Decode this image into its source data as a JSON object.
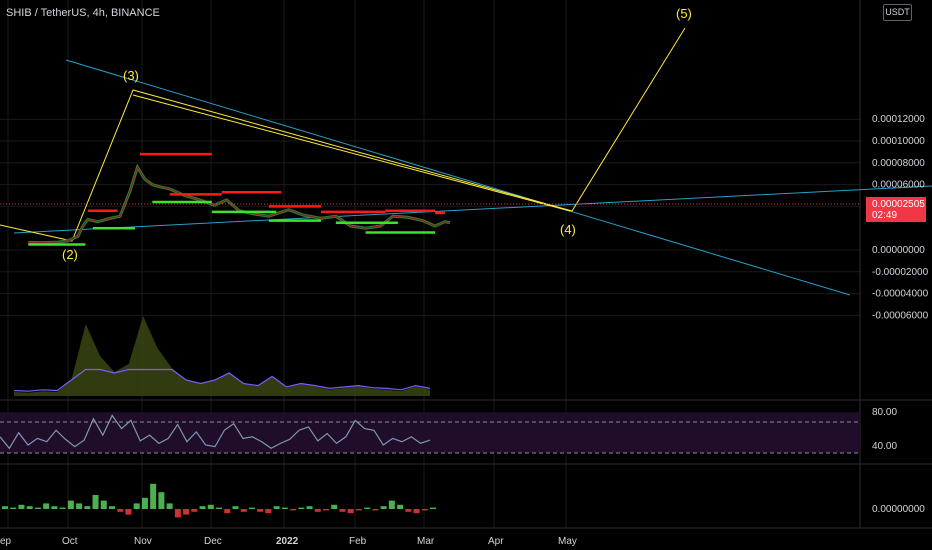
{
  "symbol": "SHIB / TetherUS, 4h, BINANCE",
  "unit": "USDT",
  "last_price": "0.00002505",
  "countdown": "02:49",
  "colors": {
    "background": "#000000",
    "candles": "#2e7d32",
    "trendline": "#26a0c8",
    "wave": "#ffeb3b",
    "resistance": "#ff1a1a",
    "support": "#39e52c",
    "rsi_line": "#7f97b2",
    "rsi_band": "#1f0d2a",
    "osc_pos": "#4caf50",
    "osc_neg": "#d32f2f",
    "price_tag": "#f23645",
    "volume_ma": "#7b5cff"
  },
  "chart_data": [
    {
      "type": "line",
      "panel": "price",
      "y_ticks": [
        "0.00012000",
        "0.00010000",
        "0.00008000",
        "0.00006000",
        "0.00004000",
        "0.00000000",
        "-0.00002000",
        "-0.00004000",
        "-0.00006000"
      ],
      "ylim": [
        -7e-05,
        0.000125
      ],
      "x_ticks": [
        "ep",
        "Oct",
        "Nov",
        "Dec",
        "2022",
        "Feb",
        "Mar",
        "Apr",
        "May"
      ],
      "price_series": [
        {
          "x": "Sep 14",
          "y": 7e-06
        },
        {
          "x": "Sep 20",
          "y": 6.8e-06
        },
        {
          "x": "Sep 26",
          "y": 7.2e-06
        },
        {
          "x": "Sep 30",
          "y": 8.5e-06
        },
        {
          "x": "Oct 4",
          "y": 1.25e-05
        },
        {
          "x": "Oct 6",
          "y": 2.2e-05
        },
        {
          "x": "Oct 8",
          "y": 2.8e-05
        },
        {
          "x": "Oct 12",
          "y": 2.6e-05
        },
        {
          "x": "Oct 17",
          "y": 2.9e-05
        },
        {
          "x": "Oct 21",
          "y": 3.1e-05
        },
        {
          "x": "Oct 25",
          "y": 5.4e-05
        },
        {
          "x": "Oct 28",
          "y": 7.6e-05
        },
        {
          "x": "Oct 31",
          "y": 6.5e-05
        },
        {
          "x": "Nov 3",
          "y": 6e-05
        },
        {
          "x": "Nov 6",
          "y": 5.8e-05
        },
        {
          "x": "Nov 10",
          "y": 5.6e-05
        },
        {
          "x": "Nov 16",
          "y": 5e-05
        },
        {
          "x": "Nov 22",
          "y": 4.6e-05
        },
        {
          "x": "Nov 28",
          "y": 4.1e-05
        },
        {
          "x": "Dec 3",
          "y": 4.6e-05
        },
        {
          "x": "Dec 8",
          "y": 3.6e-05
        },
        {
          "x": "Dec 14",
          "y": 3.3e-05
        },
        {
          "x": "Dec 20",
          "y": 3.1e-05
        },
        {
          "x": "Dec 28",
          "y": 3.7e-05
        },
        {
          "x": "Jan 3",
          "y": 3.2e-05
        },
        {
          "x": "Jan 10",
          "y": 2.9e-05
        },
        {
          "x": "Jan 16",
          "y": 3.1e-05
        },
        {
          "x": "Jan 22",
          "y": 2.2e-05
        },
        {
          "x": "Jan 28",
          "y": 2e-05
        },
        {
          "x": "Feb 3",
          "y": 2.2e-05
        },
        {
          "x": "Feb 8",
          "y": 3.1e-05
        },
        {
          "x": "Feb 14",
          "y": 3e-05
        },
        {
          "x": "Feb 20",
          "y": 2.7e-05
        },
        {
          "x": "Feb 25",
          "y": 2.2e-05
        },
        {
          "x": "Mar 1",
          "y": 2.6e-05
        },
        {
          "x": "Mar 3",
          "y": 2.5e-05
        }
      ],
      "wave_labels": [
        "(2)",
        "(3)",
        "(4)",
        "(5)"
      ],
      "resistance_levels": [
        {
          "from": "Oct 8",
          "to": "Oct 20",
          "y": 3.6e-05
        },
        {
          "from": "Oct 29",
          "to": "Nov 27",
          "y": 8.8e-05
        },
        {
          "from": "Nov 10",
          "to": "Dec 1",
          "y": 5.1e-05
        },
        {
          "from": "Dec 1",
          "to": "Dec 25",
          "y": 5.3e-05
        },
        {
          "from": "Dec 20",
          "to": "Jan 10",
          "y": 4e-05
        },
        {
          "from": "Jan 10",
          "to": "Feb 5",
          "y": 3.5e-05
        },
        {
          "from": "Feb 5",
          "to": "Feb 25",
          "y": 3.6e-05
        },
        {
          "from": "Feb 25",
          "to": "Mar 1",
          "y": 3.4e-05
        }
      ],
      "support_levels": [
        {
          "from": "Sep 14",
          "to": "Oct 7",
          "y": 5e-06
        },
        {
          "from": "Oct 10",
          "to": "Oct 27",
          "y": 2e-05
        },
        {
          "from": "Nov 3",
          "to": "Nov 27",
          "y": 4.4e-05
        },
        {
          "from": "Nov 27",
          "to": "Dec 23",
          "y": 3.5e-05
        },
        {
          "from": "Dec 20",
          "to": "Jan 10",
          "y": 2.7e-05
        },
        {
          "from": "Jan 16",
          "to": "Feb 10",
          "y": 2.5e-05
        },
        {
          "from": "Jan 28",
          "to": "Feb 25",
          "y": 1.6e-05
        }
      ]
    },
    {
      "type": "area",
      "panel": "volume",
      "values": [
        0.05,
        0.04,
        0.06,
        0.05,
        0.2,
        0.9,
        0.5,
        0.3,
        0.4,
        1.0,
        0.6,
        0.35,
        0.2,
        0.15,
        0.2,
        0.3,
        0.15,
        0.12,
        0.25,
        0.1,
        0.15,
        0.12,
        0.08,
        0.1,
        0.12,
        0.09,
        0.08,
        0.06,
        0.12,
        0.08
      ]
    },
    {
      "type": "line",
      "panel": "rsi",
      "y_ticks": [
        "80.00",
        "40.00"
      ],
      "ylim": [
        20,
        90
      ],
      "values": [
        50,
        36,
        55,
        40,
        48,
        44,
        58,
        47,
        38,
        46,
        72,
        52,
        76,
        60,
        70,
        45,
        52,
        42,
        48,
        65,
        44,
        56,
        40,
        38,
        58,
        66,
        48,
        50,
        44,
        36,
        42,
        47,
        58,
        62,
        45,
        54,
        42,
        50,
        70,
        60,
        58,
        40,
        48,
        44,
        50,
        42,
        46
      ]
    },
    {
      "type": "bar",
      "panel": "oscillator",
      "y_ticks": [
        "0.00000000"
      ],
      "values": [
        0.1,
        0.05,
        0.15,
        0.1,
        0.05,
        0.2,
        0.1,
        0.05,
        0.3,
        0.2,
        0.1,
        0.5,
        0.3,
        0.1,
        -0.1,
        -0.2,
        0.2,
        0.4,
        0.9,
        0.6,
        0.2,
        -0.3,
        -0.2,
        -0.1,
        0.1,
        0.15,
        0.05,
        -0.15,
        0.1,
        -0.1,
        0.05,
        -0.1,
        -0.15,
        0.1,
        0.05,
        -0.05,
        0.05,
        0.1,
        -0.1,
        -0.05,
        0.15,
        -0.1,
        -0.15,
        -0.05,
        0.05,
        -0.05,
        0.1,
        0.3,
        0.15,
        -0.1,
        -0.15,
        -0.05,
        0.05
      ]
    }
  ]
}
